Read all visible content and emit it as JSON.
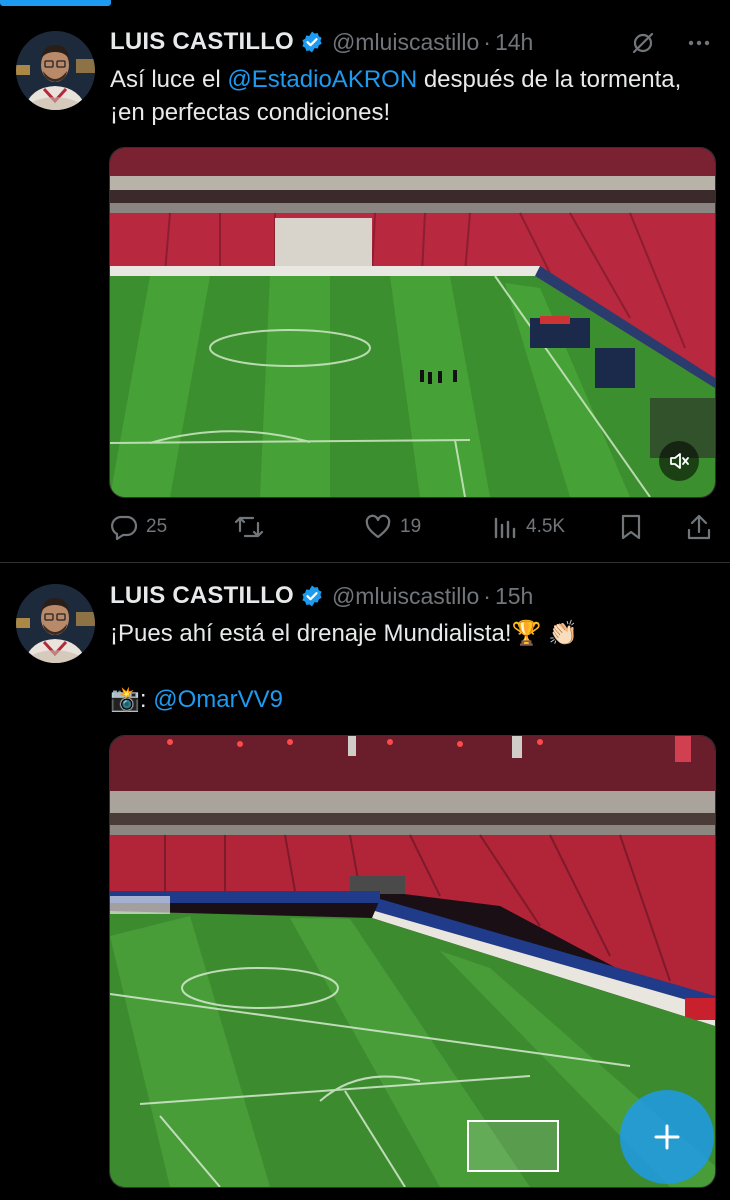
{
  "tweets": [
    {
      "author_name": "LUIS CASTILLO",
      "handle": "@mluiscastillo",
      "separator": "·",
      "time": "14h",
      "text_before": "Así luce el ",
      "mention": "@EstadioAKRON",
      "text_after": " después de la tormenta, ¡en perfectas condiciones!",
      "media_type": "video",
      "stats": {
        "replies": "25",
        "likes": "19",
        "views": "4.5K"
      }
    },
    {
      "author_name": "LUIS CASTILLO",
      "handle": "@mluiscastillo",
      "separator": "·",
      "time": "15h",
      "text_line1": "¡Pues ahí está el drenaje Mundialista!",
      "emoji_trophy": "🏆",
      "emoji_clap": "👏🏻",
      "emoji_camera": "📸",
      "colon": ":",
      "mention": "@OmarVV9",
      "media_type": "photo"
    }
  ],
  "colors": {
    "accent": "#1d9bf0",
    "muted": "#71767b",
    "text": "#e7e9ea",
    "background": "#000000"
  },
  "icons": [
    "grok-icon",
    "more-icon",
    "reply-icon",
    "retweet-icon",
    "like-icon",
    "views-icon",
    "bookmark-icon",
    "share-icon",
    "mute-icon",
    "compose-icon"
  ]
}
